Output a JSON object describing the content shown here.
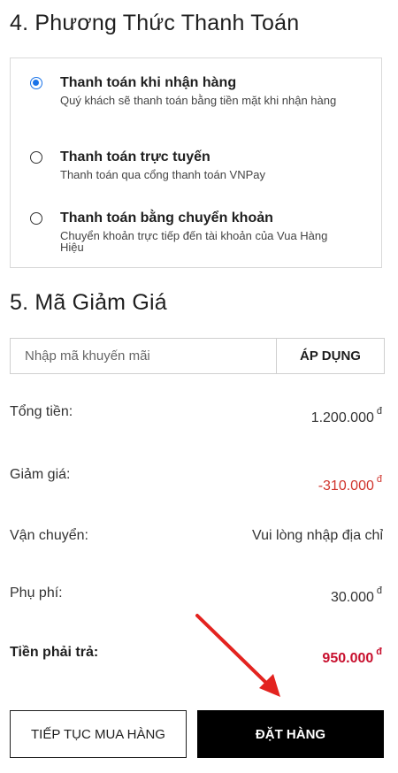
{
  "payment": {
    "title": "4. Phương Thức Thanh Toán",
    "options": [
      {
        "title": "Thanh toán khi nhận hàng",
        "desc": "Quý khách sẽ thanh toán bằng tiền mặt khi nhận hàng",
        "selected": true
      },
      {
        "title": "Thanh toán trực tuyến",
        "desc": "Thanh toán qua cổng thanh toán VNPay",
        "selected": false
      },
      {
        "title": "Thanh toán bằng chuyển khoản",
        "desc": "Chuyển khoản trực tiếp đến tài khoản của Vua Hàng Hiệu",
        "selected": false
      }
    ]
  },
  "discount": {
    "title": "5. Mã Giảm Giá",
    "placeholder": "Nhập mã khuyến mãi",
    "apply_label": "ÁP DỤNG"
  },
  "summary": {
    "currency": "đ",
    "subtotal_label": "Tổng tiền:",
    "subtotal_value": "1.200.000",
    "discount_label": "Giảm giá:",
    "discount_value": "-310.000",
    "shipping_label": "Vận chuyển:",
    "shipping_value": "Vui lòng nhập địa chỉ",
    "fee_label": "Phụ phí:",
    "fee_value": "30.000",
    "total_label": "Tiền phải trả:",
    "total_value": "950.000"
  },
  "actions": {
    "continue_label": "TIẾP TỤC MUA HÀNG",
    "order_label": "ĐẶT HÀNG"
  },
  "colors": {
    "radio_selected": "#1a73e8",
    "discount_text": "#d0342c",
    "total_text": "#c8102e",
    "annotation_arrow": "#e3231f",
    "order_button_bg": "#000000"
  }
}
